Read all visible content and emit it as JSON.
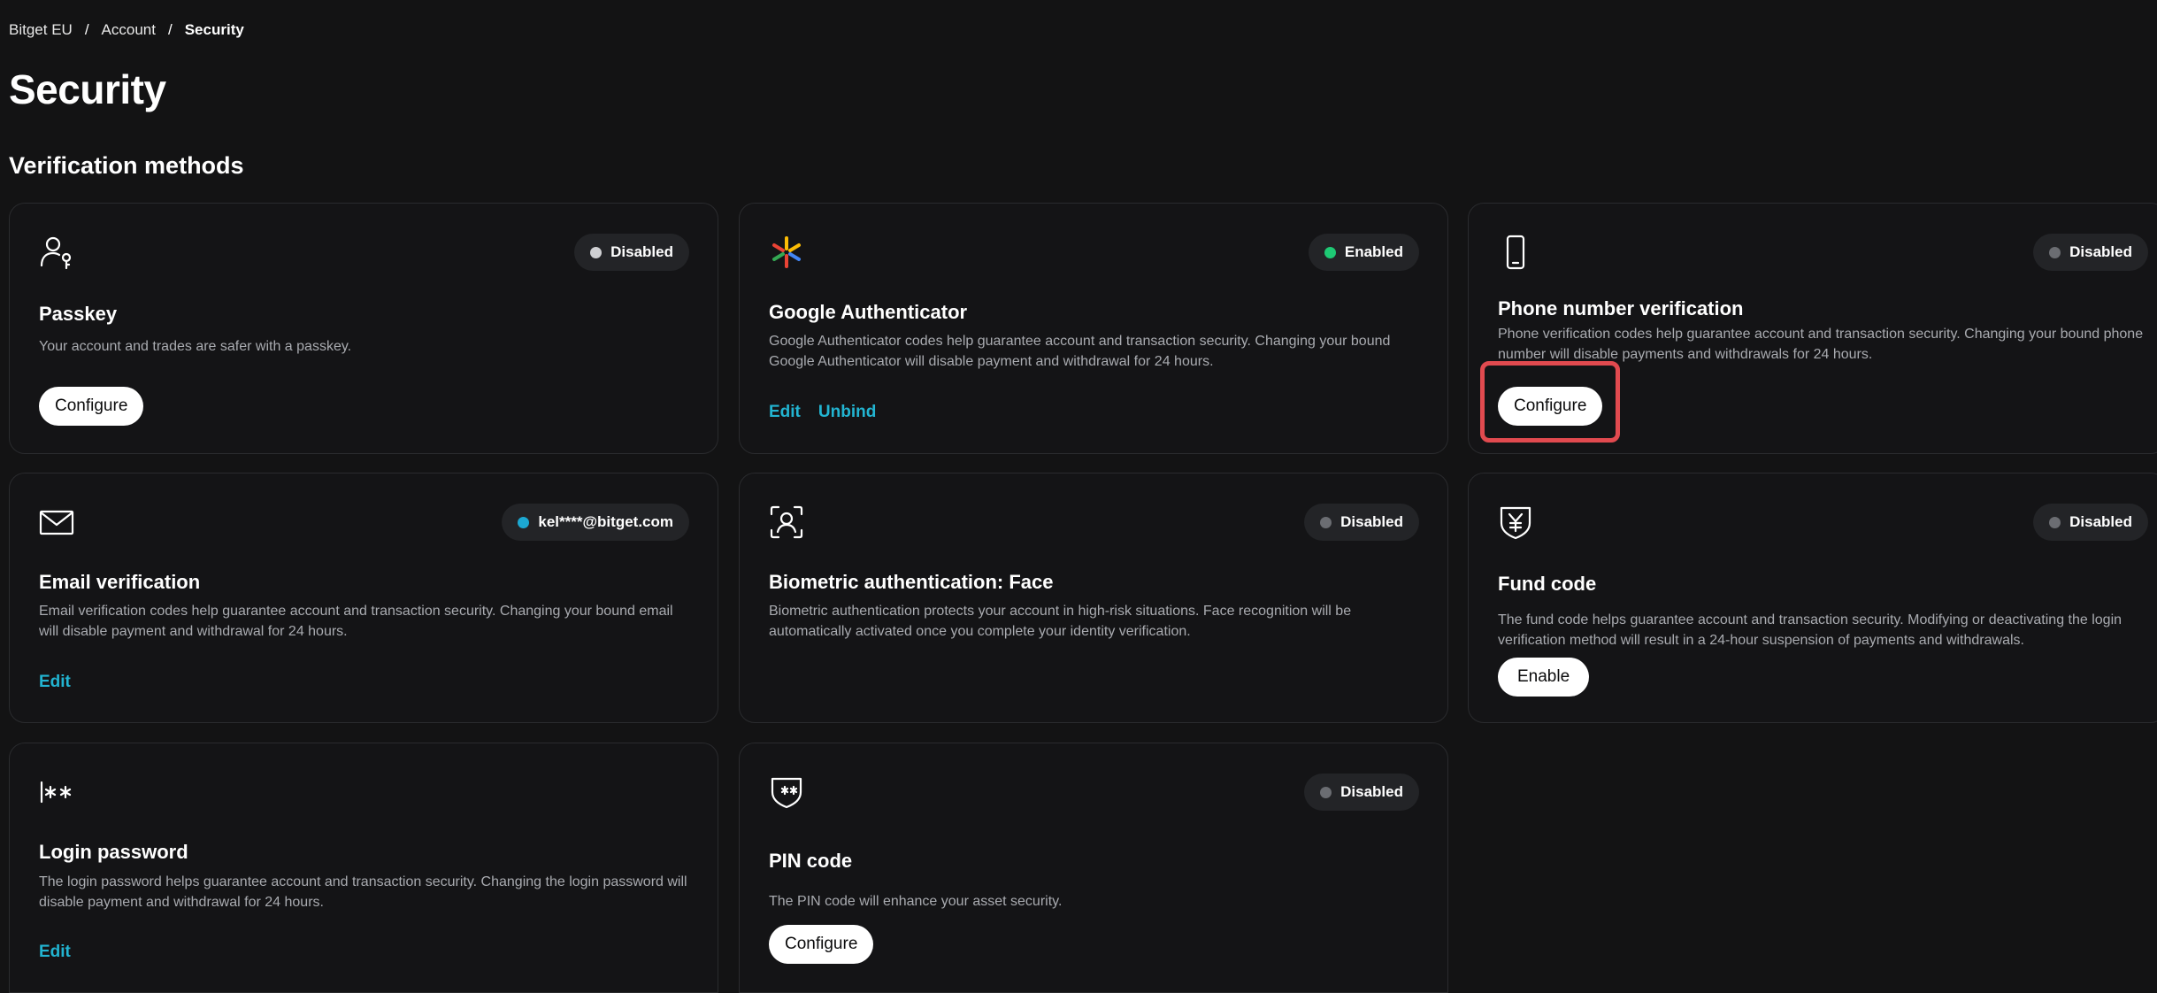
{
  "breadcrumb": {
    "items": [
      "Bitget EU",
      "Account",
      "Security"
    ],
    "separator": "/"
  },
  "page_title": "Security",
  "section_title": "Verification methods",
  "colors": {
    "background": "#131314",
    "card_border": "#2a2b2e",
    "link": "#22b4d1",
    "enabled_dot": "#1ec974",
    "disabled_dot_light": "#cfd0d3",
    "disabled_dot_dark": "#6b6d72",
    "email_dot": "#1ca8d2",
    "highlight": "#e14a4f"
  },
  "cards": {
    "passkey": {
      "icon": "user-key-icon",
      "status": "Disabled",
      "title": "Passkey",
      "description": "Your account and trades are safer with a passkey.",
      "button": "Configure"
    },
    "google": {
      "icon": "google-authenticator-icon",
      "status": "Enabled",
      "title": "Google Authenticator",
      "description": "Google Authenticator codes help guarantee account and transaction security. Changing your bound Google Authenticator will disable payment and withdrawal for 24 hours.",
      "links": [
        "Edit",
        "Unbind"
      ]
    },
    "phone": {
      "icon": "phone-icon",
      "status": "Disabled",
      "title": "Phone number verification",
      "description": "Phone verification codes help guarantee account and transaction security. Changing your bound phone number will disable payments and withdrawals for 24 hours.",
      "button": "Configure"
    },
    "email": {
      "icon": "mail-icon",
      "status": "kel****@bitget.com",
      "title": "Email verification",
      "description": "Email verification codes help guarantee account and transaction security. Changing your bound email will disable payment and withdrawal for 24 hours.",
      "links": [
        "Edit"
      ]
    },
    "biometric": {
      "icon": "face-scan-icon",
      "status": "Disabled",
      "title": "Biometric authentication: Face",
      "description": "Biometric authentication protects your account in high-risk situations. Face recognition will be automatically activated once you complete your identity verification."
    },
    "fund": {
      "icon": "yen-shield-icon",
      "status": "Disabled",
      "title": "Fund code",
      "description": "The fund code helps guarantee account and transaction security. Modifying or deactivating the login verification method will result in a 24-hour suspension of payments and withdrawals.",
      "button": "Enable"
    },
    "login": {
      "icon": "password-icon",
      "title": "Login password",
      "description": "The login password helps guarantee account and transaction security. Changing the login password will disable payment and withdrawal for 24 hours.",
      "links": [
        "Edit"
      ]
    },
    "pin": {
      "icon": "pin-shield-icon",
      "status": "Disabled",
      "title": "PIN code",
      "description": "The PIN code will enhance your asset security.",
      "button": "Configure"
    }
  }
}
